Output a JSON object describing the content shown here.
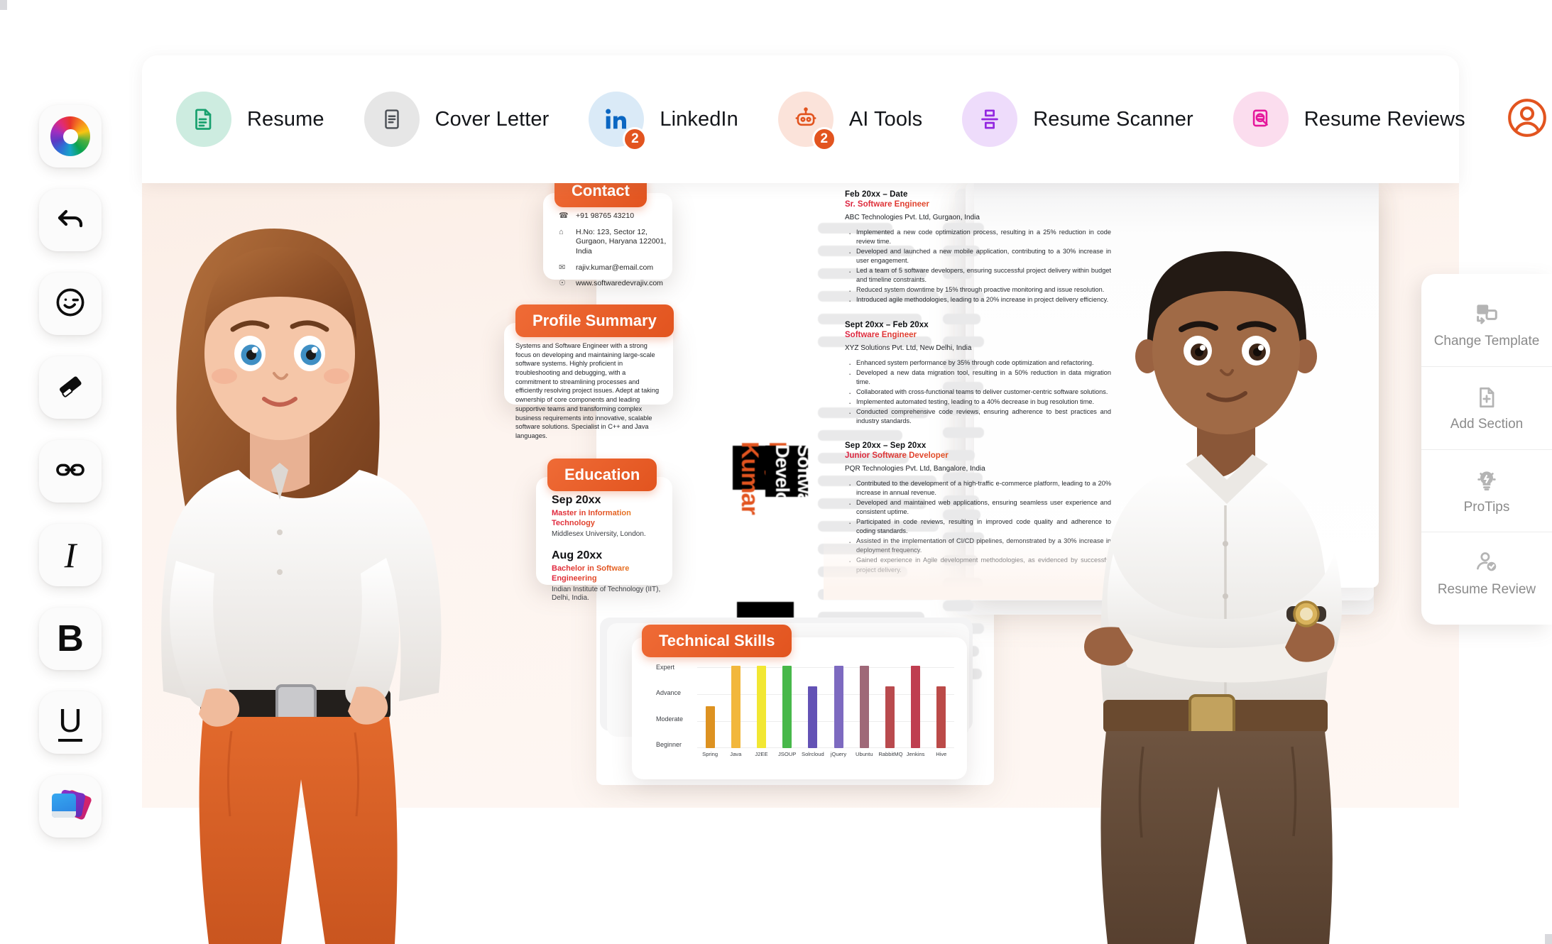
{
  "app": {
    "canvas_bg": "#fdf4ef",
    "accent": "#e2541f"
  },
  "left_toolbar": {
    "items": [
      {
        "name": "color-wheel-icon",
        "glyph": "",
        "label": "Color"
      },
      {
        "name": "undo-icon",
        "glyph": "↶",
        "label": "Undo"
      },
      {
        "name": "emoji-icon",
        "glyph": "☺",
        "label": "Emoji"
      },
      {
        "name": "eraser-icon",
        "glyph": "▰",
        "label": "Eraser"
      },
      {
        "name": "link-icon",
        "glyph": "⚭",
        "label": "Link"
      },
      {
        "name": "italic-icon",
        "glyph": "I",
        "label": "Italic"
      },
      {
        "name": "bold-icon",
        "glyph": "B",
        "label": "Bold"
      },
      {
        "name": "underline-icon",
        "glyph": "U",
        "label": "Underline"
      },
      {
        "name": "layers-icon",
        "glyph": "",
        "label": "Layers"
      }
    ]
  },
  "topnav": {
    "items": [
      {
        "label": "Resume",
        "icon": "document-icon",
        "bg": "#cdece0",
        "fg": "#17a06e",
        "badge": null
      },
      {
        "label": "Cover Letter",
        "icon": "letter-icon",
        "bg": "#e6e6e6",
        "fg": "#4b4f55",
        "badge": null
      },
      {
        "label": "LinkedIn",
        "icon": "linkedin-icon",
        "bg": "#daeaf7",
        "fg": "#0a66c2",
        "badge": "2"
      },
      {
        "label": "AI Tools",
        "icon": "robot-icon",
        "bg": "#fbe3da",
        "fg": "#e2541f",
        "badge": "2"
      },
      {
        "label": "Resume Scanner",
        "icon": "scanner-icon",
        "bg": "#eedcfb",
        "fg": "#9327e0",
        "badge": null
      },
      {
        "label": "Resume Reviews",
        "icon": "review-icon",
        "bg": "#fbddee",
        "fg": "#e5189c",
        "badge": null
      }
    ],
    "avatar": {
      "name": "user-avatar-icon",
      "color": "#e2541f"
    }
  },
  "right_panel": {
    "items": [
      {
        "label": "Change Template",
        "icon": "change-template-icon"
      },
      {
        "label": "Add Section",
        "icon": "add-section-icon"
      },
      {
        "label": "ProTips",
        "icon": "lightbulb-icon"
      },
      {
        "label": "Resume Review",
        "icon": "person-check-icon"
      }
    ]
  },
  "resume": {
    "banner_name": "Rajiv Kumar",
    "banner_role": "Software Developer",
    "contact": {
      "tag": "Contact",
      "rows": [
        {
          "icon": "phone-icon",
          "text": "+91 98765 43210"
        },
        {
          "icon": "home-icon",
          "text": "H.No: 123, Sector 12, Gurgaon, Haryana 122001, India"
        },
        {
          "icon": "mail-icon",
          "text": "rajiv.kumar@email.com"
        },
        {
          "icon": "globe-icon",
          "text": "www.softwaredevrajiv.com"
        }
      ]
    },
    "summary": {
      "tag": "Profile Summary",
      "text": "Systems and Software Engineer with a strong focus on developing and maintaining large-scale software systems. Highly proficient in troubleshooting and debugging, with a commitment to streamlining processes and efficiently resolving project issues. Adept at taking ownership of core components and leading supportive teams and transforming complex business requirements into innovative, scalable software solutions. Specialist in C++ and Java languages."
    },
    "education": {
      "tag": "Education",
      "entries": [
        {
          "date": "Sep 20xx",
          "title": "Master in Information Technology",
          "school": "Middlesex University, London."
        },
        {
          "date": "Aug 20xx",
          "title": "Bachelor in Software Engineering",
          "school": "Indian Institute of Technology (IIT), Delhi, India."
        }
      ]
    },
    "experience": [
      {
        "date": "Feb 20xx – Date",
        "title": "Sr. Software Engineer",
        "company": "ABC Technologies Pvt. Ltd, Gurgaon, India",
        "bullets": [
          "Implemented a new code optimization process, resulting in a 25% reduction in code review time.",
          "Developed and launched a new mobile application, contributing to a 30% increase in user engagement.",
          "Led a team of 5 software developers, ensuring successful project delivery within budget and timeline constraints.",
          "Reduced system downtime by 15% through proactive monitoring and issue resolution.",
          "Introduced agile methodologies, leading to a 20% increase in project delivery efficiency."
        ]
      },
      {
        "date": "Sept 20xx – Feb 20xx",
        "title": "Software Engineer",
        "company": "XYZ Solutions Pvt. Ltd, New Delhi, India",
        "bullets": [
          "Enhanced system performance by 35% through code optimization and refactoring.",
          "Developed a new data migration tool, resulting in a 50% reduction in data migration time.",
          "Collaborated with cross-functional teams to deliver customer-centric software solutions.",
          "Implemented automated testing, leading to a 40% decrease in bug resolution time.",
          "Conducted comprehensive code reviews, ensuring adherence to best practices and industry standards."
        ]
      },
      {
        "date": "Sep 20xx – Sep 20xx",
        "title": "Junior Software Developer",
        "company": "PQR Technologies Pvt. Ltd, Bangalore, India",
        "bullets": [
          "Contributed to the development of a high-traffic e-commerce platform, leading to a 20% increase in annual revenue.",
          "Developed and maintained web applications, ensuring seamless user experience and consistent uptime.",
          "Participated in code reviews, resulting in improved code quality and adherence to coding standards.",
          "Assisted in the implementation of CI/CD pipelines, demonstrated by a 30% increase in deployment frequency.",
          "Gained experience in Agile development methodologies, as evidenced by successful project delivery."
        ]
      }
    ]
  },
  "chart_data": {
    "type": "bar",
    "title": "Technical Skills",
    "xlabel": "",
    "ylabel": "",
    "grid": true,
    "legend": false,
    "categories": [
      "Spring",
      "Java",
      "J2EE",
      "JSOUP",
      "Solrcloud",
      "jQuery",
      "Ubuntu",
      "RabbitMQ",
      "Jenkins",
      "Hive"
    ],
    "tick_labels": [
      "Expert",
      "Advance",
      "Moderate",
      "Beginner"
    ],
    "ylim": [
      0,
      4
    ],
    "values": [
      2,
      4,
      4,
      4,
      3,
      4,
      4,
      3,
      4,
      3
    ],
    "value_labels": [
      "Moderate",
      "Expert",
      "Expert",
      "Expert",
      "Advance",
      "Expert",
      "Expert",
      "Advance",
      "Expert",
      "Advance"
    ],
    "colors": [
      "#dd9221",
      "#f2b73c",
      "#f2e732",
      "#48b84a",
      "#6352b5",
      "#7d6ac0",
      "#9f6878",
      "#b94a4e",
      "#bf3e50",
      "#bb4a48"
    ]
  }
}
